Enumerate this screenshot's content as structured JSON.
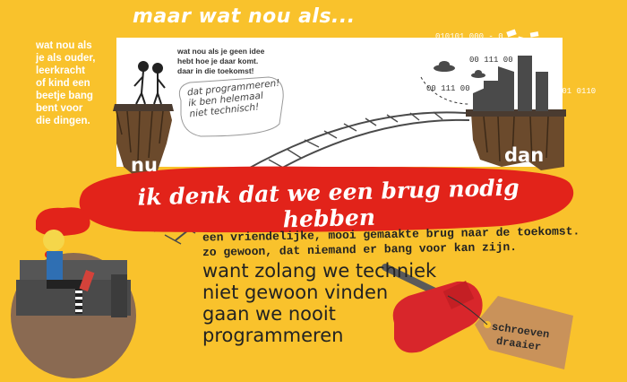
{
  "header": {
    "title": "maar wat nou als..."
  },
  "left_note": {
    "lines": [
      "wat nou als",
      "je als ouder,",
      "leerkracht",
      "of kind een",
      "beetje bang",
      "bent voor",
      "die dingen."
    ]
  },
  "scene": {
    "top_note_lines": [
      "wat nou als je geen idee",
      "hebt hoe je daar komt.",
      "daar in die toekomst!"
    ],
    "speech_lines": [
      "dat programmeren!",
      "ik ben helemaal",
      "niet technisch!"
    ],
    "code_labels": [
      "010101 000 - 0",
      "00 111 00",
      "00 111 00",
      "001 0110"
    ],
    "now_label": "nu",
    "then_label": "dan"
  },
  "banner": {
    "text": "ik denk dat we een brug nodig hebben"
  },
  "subtitle": {
    "line1": "een vriendelijke, mooi gemaakte brug naar de toekomst.",
    "line2": "zo gewoon, dat niemand er bang voor kan zijn."
  },
  "handwritten": {
    "lines": [
      "want zolang we techniek",
      "niet gewoon vinden",
      "gaan we nooit",
      "programmeren"
    ]
  },
  "tag": {
    "lines": [
      "schroeven",
      "draaier"
    ]
  },
  "colors": {
    "background": "#f9c22c",
    "banner": "#e2231a",
    "screwdriver": "#d8262b",
    "tag": "#c9925a"
  }
}
